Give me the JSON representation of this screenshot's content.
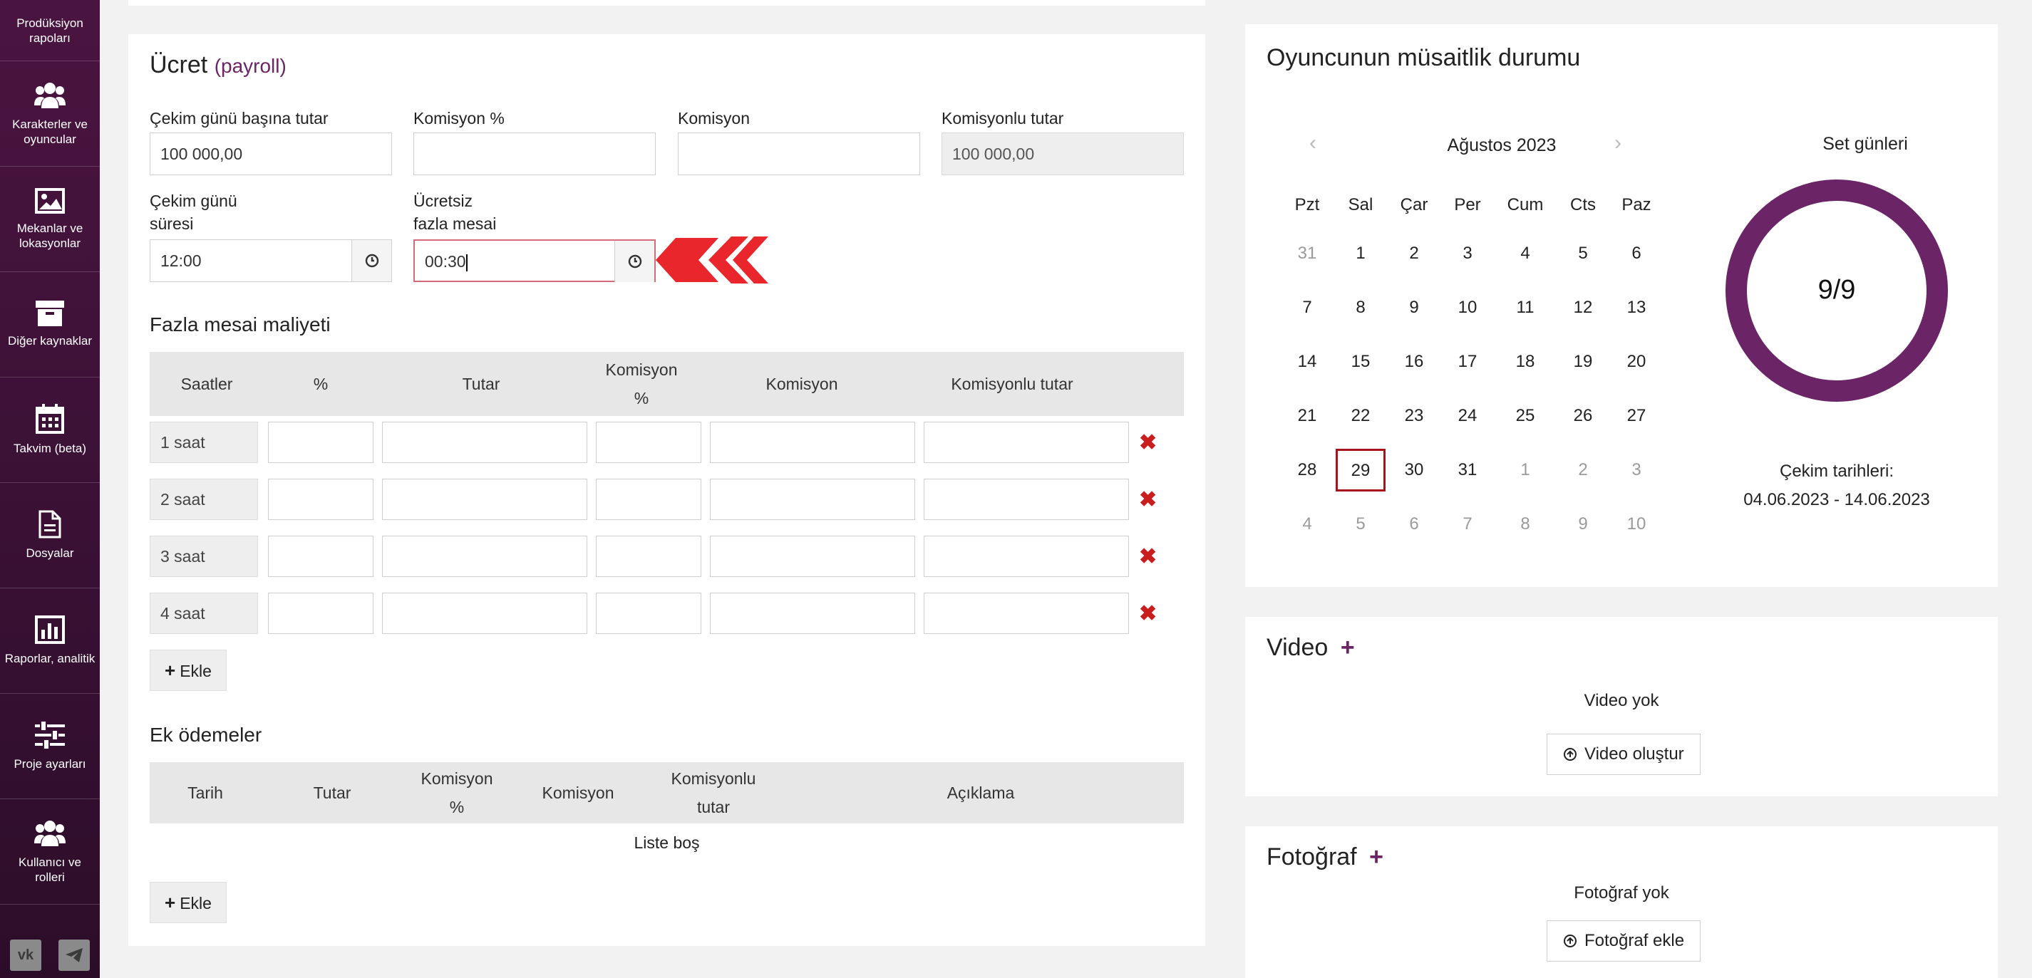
{
  "sidebar": {
    "items": [
      {
        "label": "Prodüksiyon rapoları",
        "icon": "reports-icon"
      },
      {
        "label": "Karakterler ve oyuncular",
        "icon": "users-icon"
      },
      {
        "label": "Mekanlar ve lokasyonlar",
        "icon": "image-icon"
      },
      {
        "label": "Diğer kaynaklar",
        "icon": "archive-icon"
      },
      {
        "label": "Takvim (beta)",
        "icon": "calendar-icon"
      },
      {
        "label": "Dosyalar",
        "icon": "file-icon"
      },
      {
        "label": "Raporlar, analitik",
        "icon": "bar-chart-icon"
      },
      {
        "label": "Proje ayarları",
        "icon": "sliders-icon"
      },
      {
        "label": "Kullanıcı ve rolleri",
        "icon": "users-icon"
      }
    ],
    "social": [
      "vk-icon",
      "telegram-icon"
    ]
  },
  "payroll": {
    "title": "Ücret",
    "title_tag": "(payroll)",
    "fields": {
      "per_day_label": "Çekim günü başına tutar",
      "per_day_value": "100 000,00",
      "commission_pct_label": "Komisyon %",
      "commission_pct_value": "",
      "commission_label": "Komisyon",
      "commission_value": "",
      "with_commission_label": "Komisyonlu tutar",
      "with_commission_value": "100 000,00",
      "shoot_duration_label_1": "Çekim günü",
      "shoot_duration_label_2": "süresi",
      "shoot_duration_value": "12:00",
      "free_overtime_label_1": "Ücretsiz",
      "free_overtime_label_2": "fazla mesai",
      "free_overtime_value": "00:30"
    },
    "overtime": {
      "title": "Fazla mesai maliyeti",
      "headers": [
        "Saatler",
        "%",
        "Tutar",
        "Komisyon",
        "%",
        "Komisyon",
        "Komisyonlu tutar"
      ],
      "rows": [
        "1 saat",
        "2 saat",
        "3 saat",
        "4 saat"
      ],
      "add_label": "Ekle"
    },
    "extra": {
      "title": "Ek ödemeler",
      "headers": [
        "Tarih",
        "Tutar",
        "Komisyon",
        "%",
        "Komisyon",
        "Komisyonlu",
        "tutar",
        "Açıklama"
      ],
      "empty": "Liste boş",
      "add_label": "Ekle"
    }
  },
  "availability": {
    "title": "Oyuncunun müsaitlik durumu",
    "month": "Ağustos 2023",
    "weekdays": [
      "Pzt",
      "Sal",
      "Çar",
      "Per",
      "Cum",
      "Cts",
      "Paz"
    ],
    "weeks": [
      [
        "31",
        "1",
        "2",
        "3",
        "4",
        "5",
        "6"
      ],
      [
        "7",
        "8",
        "9",
        "10",
        "11",
        "12",
        "13"
      ],
      [
        "14",
        "15",
        "16",
        "17",
        "18",
        "19",
        "20"
      ],
      [
        "21",
        "22",
        "23",
        "24",
        "25",
        "26",
        "27"
      ],
      [
        "28",
        "29",
        "30",
        "31",
        "1",
        "2",
        "3"
      ],
      [
        "4",
        "5",
        "6",
        "7",
        "8",
        "9",
        "10"
      ]
    ],
    "selected_day": "29",
    "set_days_label": "Set günleri",
    "set_days_value": "9/9",
    "set_days_fraction": 1.0,
    "shoot_dates_label": "Çekim tarihleri:",
    "shoot_dates_value": "04.06.2023 - 14.06.2023",
    "ring_color": "#6b2466"
  },
  "video": {
    "title": "Video",
    "empty": "Video yok",
    "button": "Video oluştur"
  },
  "photo": {
    "title": "Fotoğraf",
    "empty": "Fotoğraf yok",
    "button": "Fotoğraf ekle"
  }
}
